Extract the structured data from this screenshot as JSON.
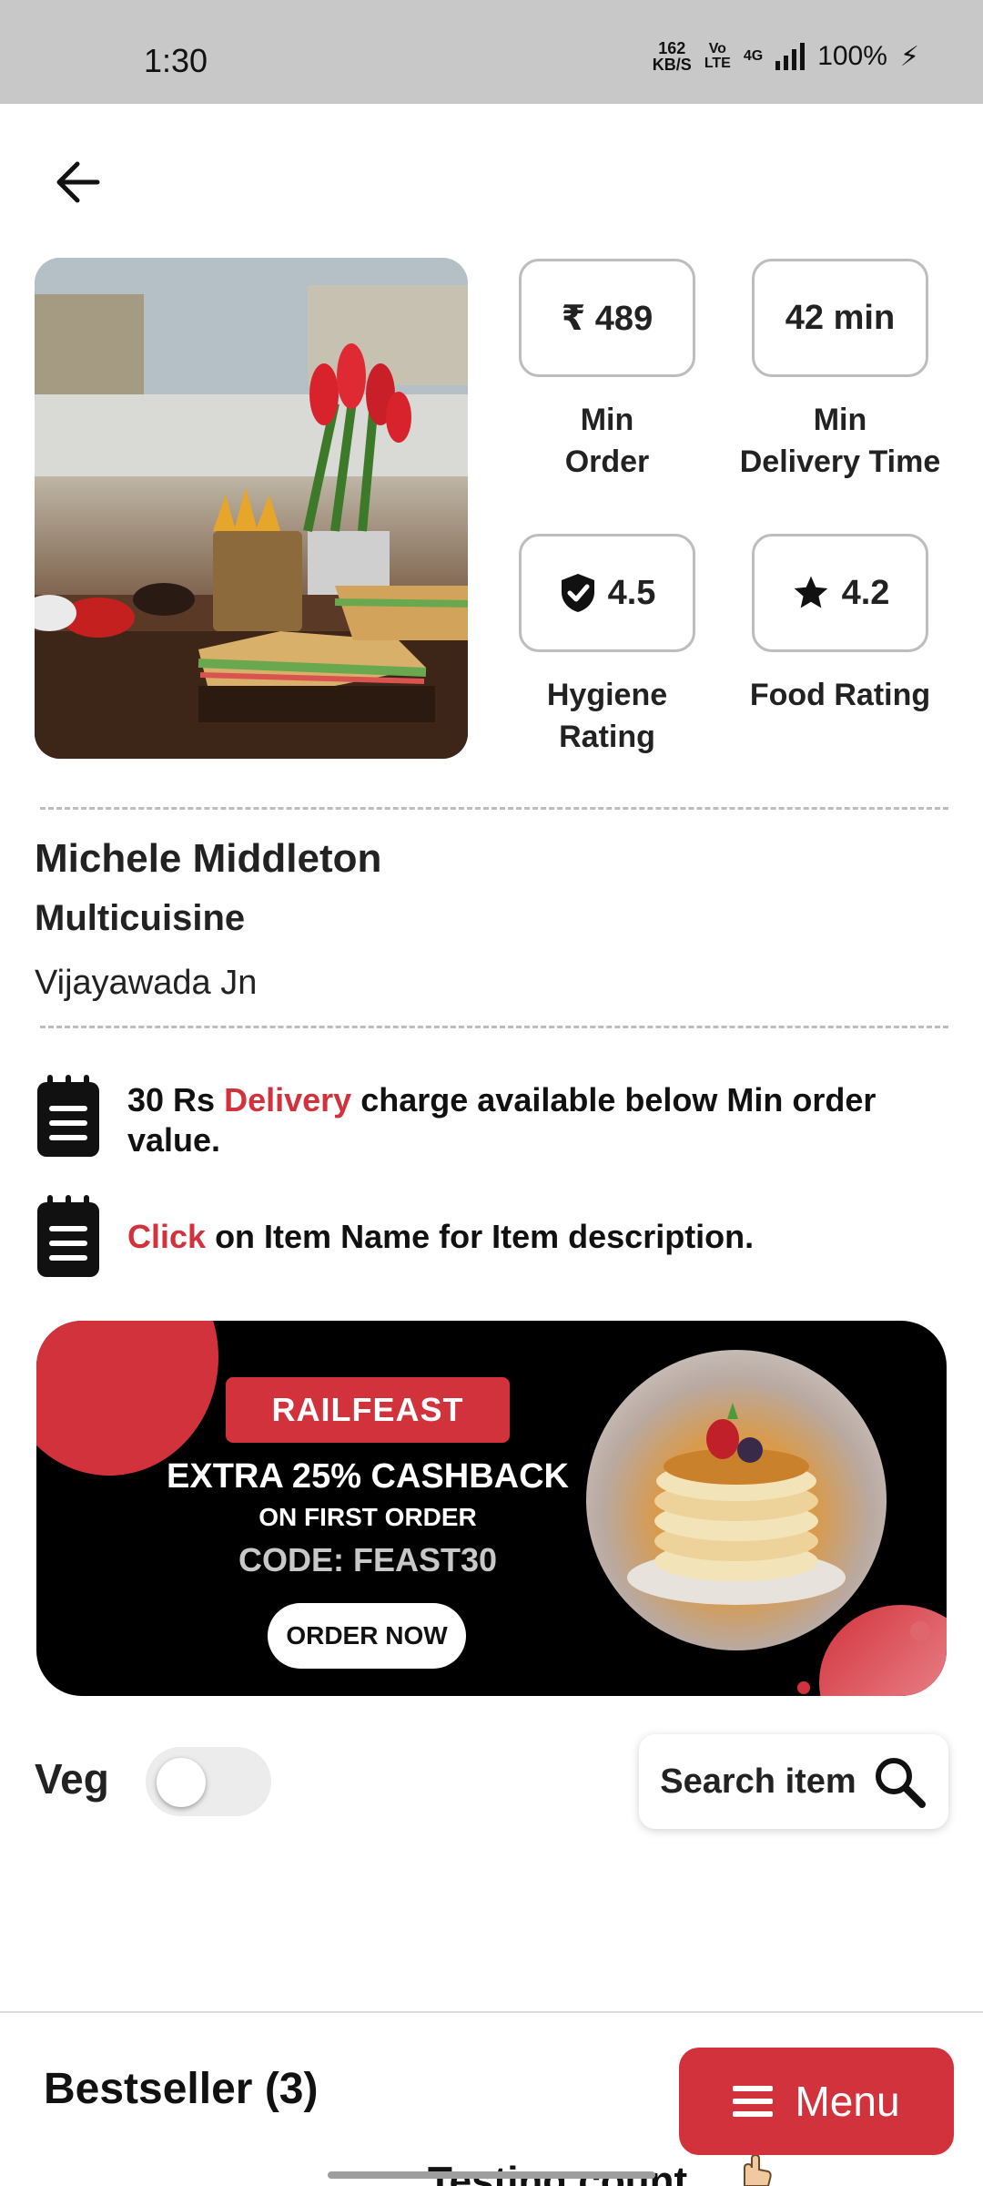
{
  "status_bar": {
    "time": "1:30",
    "net_speed_value": "162",
    "net_speed_unit": "KB/S",
    "volte_top": "Vo",
    "volte_bottom": "LTE",
    "network": "4G",
    "battery": "100%"
  },
  "stats": {
    "min_order_value": "₹ 489",
    "min_order_label_1": "Min",
    "min_order_label_2": "Order",
    "delivery_time_value": "42 min",
    "delivery_time_label_1": "Min",
    "delivery_time_label_2": "Delivery Time",
    "hygiene_value": "4.5",
    "hygiene_label_1": "Hygiene",
    "hygiene_label_2": "Rating",
    "food_rating_value": "4.2",
    "food_rating_label": "Food Rating"
  },
  "restaurant": {
    "name": "Michele Middleton",
    "cuisine": "Multicuisine",
    "station": "Vijayawada Jn"
  },
  "notices": {
    "delivery_prefix": "30 Rs",
    "delivery_accent": "Delivery",
    "delivery_suffix": "charge available below Min order value.",
    "click_accent": "Click",
    "click_suffix": "on Item Name for Item description."
  },
  "banner": {
    "tag": "RAILFEAST",
    "line1": "EXTRA 25% CASHBACK",
    "line2": "ON  FIRST ORDER",
    "code": "CODE: FEAST30",
    "button": "ORDER NOW"
  },
  "filters": {
    "veg_label": "Veg",
    "veg_on": false,
    "search_label": "Search item"
  },
  "footer": {
    "section_title": "Bestseller (3)",
    "menu_label": "Menu",
    "peek_text": "Testing count"
  },
  "colors": {
    "accent": "#d2323b",
    "status_bar": "#c8c8c8"
  },
  "icons": {
    "back": "arrow-left-icon",
    "hygiene": "shield-check-icon",
    "rating": "star-icon",
    "notice": "notepad-icon",
    "search": "magnifier-icon",
    "menu": "hamburger-icon"
  }
}
